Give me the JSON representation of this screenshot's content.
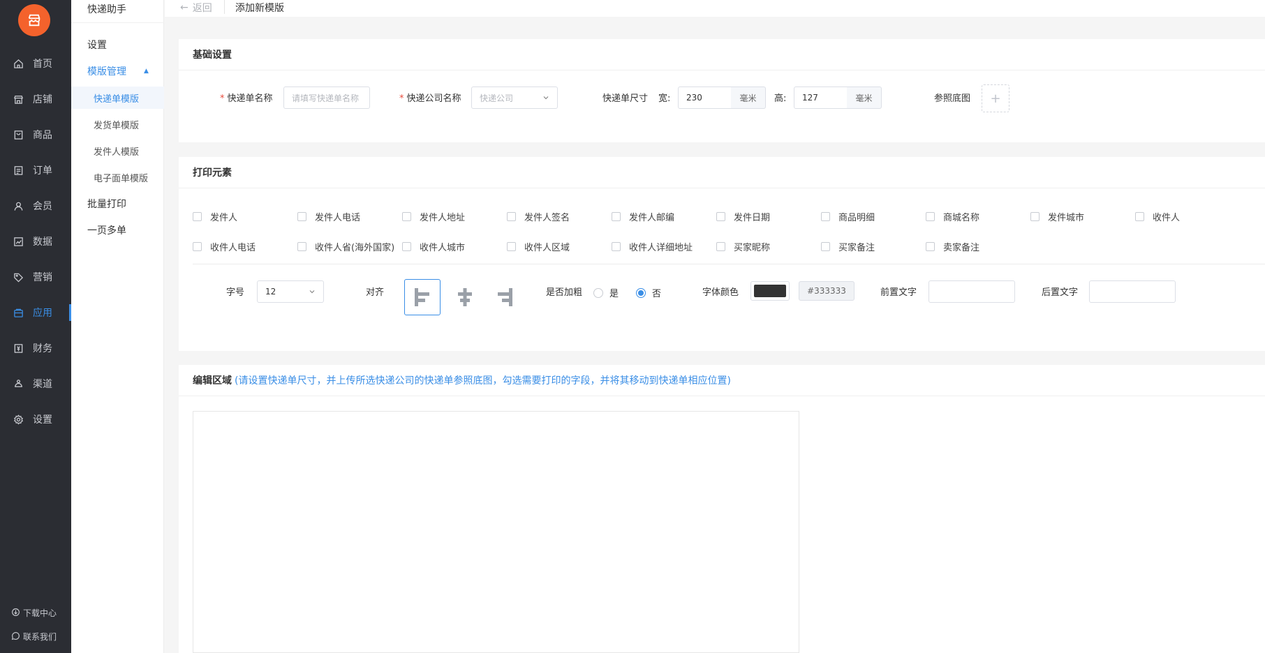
{
  "nav": {
    "logo_icon": "store-icon",
    "items": [
      {
        "label": "首页",
        "icon": "home-icon"
      },
      {
        "label": "店铺",
        "icon": "shop-icon"
      },
      {
        "label": "商品",
        "icon": "product-icon"
      },
      {
        "label": "订单",
        "icon": "order-icon"
      },
      {
        "label": "会员",
        "icon": "user-icon"
      },
      {
        "label": "数据",
        "icon": "chart-icon"
      },
      {
        "label": "营销",
        "icon": "tag-icon"
      },
      {
        "label": "应用",
        "icon": "app-icon"
      },
      {
        "label": "财务",
        "icon": "finance-icon"
      },
      {
        "label": "渠道",
        "icon": "channel-icon"
      },
      {
        "label": "设置",
        "icon": "gear-icon"
      }
    ],
    "active": "应用",
    "footer": [
      {
        "label": "下载中心",
        "icon": "download-icon"
      },
      {
        "label": "联系我们",
        "icon": "chat-icon"
      }
    ]
  },
  "subnav": {
    "title": "快递助手",
    "items": [
      {
        "label": "设置"
      },
      {
        "label": "模版管理"
      },
      {
        "label": "快递单模版"
      },
      {
        "label": "发货单模版"
      },
      {
        "label": "发件人模版"
      },
      {
        "label": "电子面单模版"
      },
      {
        "label": "批量打印"
      },
      {
        "label": "一页多单"
      }
    ]
  },
  "topbar": {
    "back_label": "返回",
    "title": "添加新模版"
  },
  "basic": {
    "header": "基础设置",
    "name_label": "快递单名称",
    "name_placeholder": "请填写快递单名称",
    "company_label": "快递公司名称",
    "company_placeholder": "快递公司",
    "size_label": "快递单尺寸",
    "width_label": "宽:",
    "width_value": "230",
    "height_label": "高:",
    "height_value": "127",
    "unit": "毫米",
    "bg_label": "参照底图",
    "upload_symbol": "+"
  },
  "print": {
    "header": "打印元素",
    "fields_row1": [
      "发件人",
      "发件人电话",
      "发件人地址",
      "发件人签名",
      "发件人邮编",
      "发件日期",
      "商品明细",
      "商城名称",
      "发件城市",
      "收件人"
    ],
    "fields_row2": [
      "收件人电话",
      "收件人省(海外国家)",
      "收件人城市",
      "收件人区域",
      "收件人详细地址",
      "买家昵称",
      "买家备注",
      "卖家备注"
    ],
    "font_size_label": "字号",
    "font_size_value": "12",
    "align_label": "对齐",
    "align_selected": "left",
    "bold_label": "是否加粗",
    "bold_yes": "是",
    "bold_no": "否",
    "bold_value": "否",
    "color_label": "字体颜色",
    "color_value": "#333333",
    "prefix_label": "前置文字",
    "suffix_label": "后置文字"
  },
  "edit": {
    "header": "编辑区域",
    "hint": "(请设置快递单尺寸，并上传所选快递公司的快递单参照底图，勾选需要打印的字段，并将其移动到快递单相应位置)"
  },
  "colors": {
    "accent": "#3a8ee6",
    "nav_bg": "#2b2d33",
    "logo": "#f4622c",
    "required": "#e84c3d"
  }
}
